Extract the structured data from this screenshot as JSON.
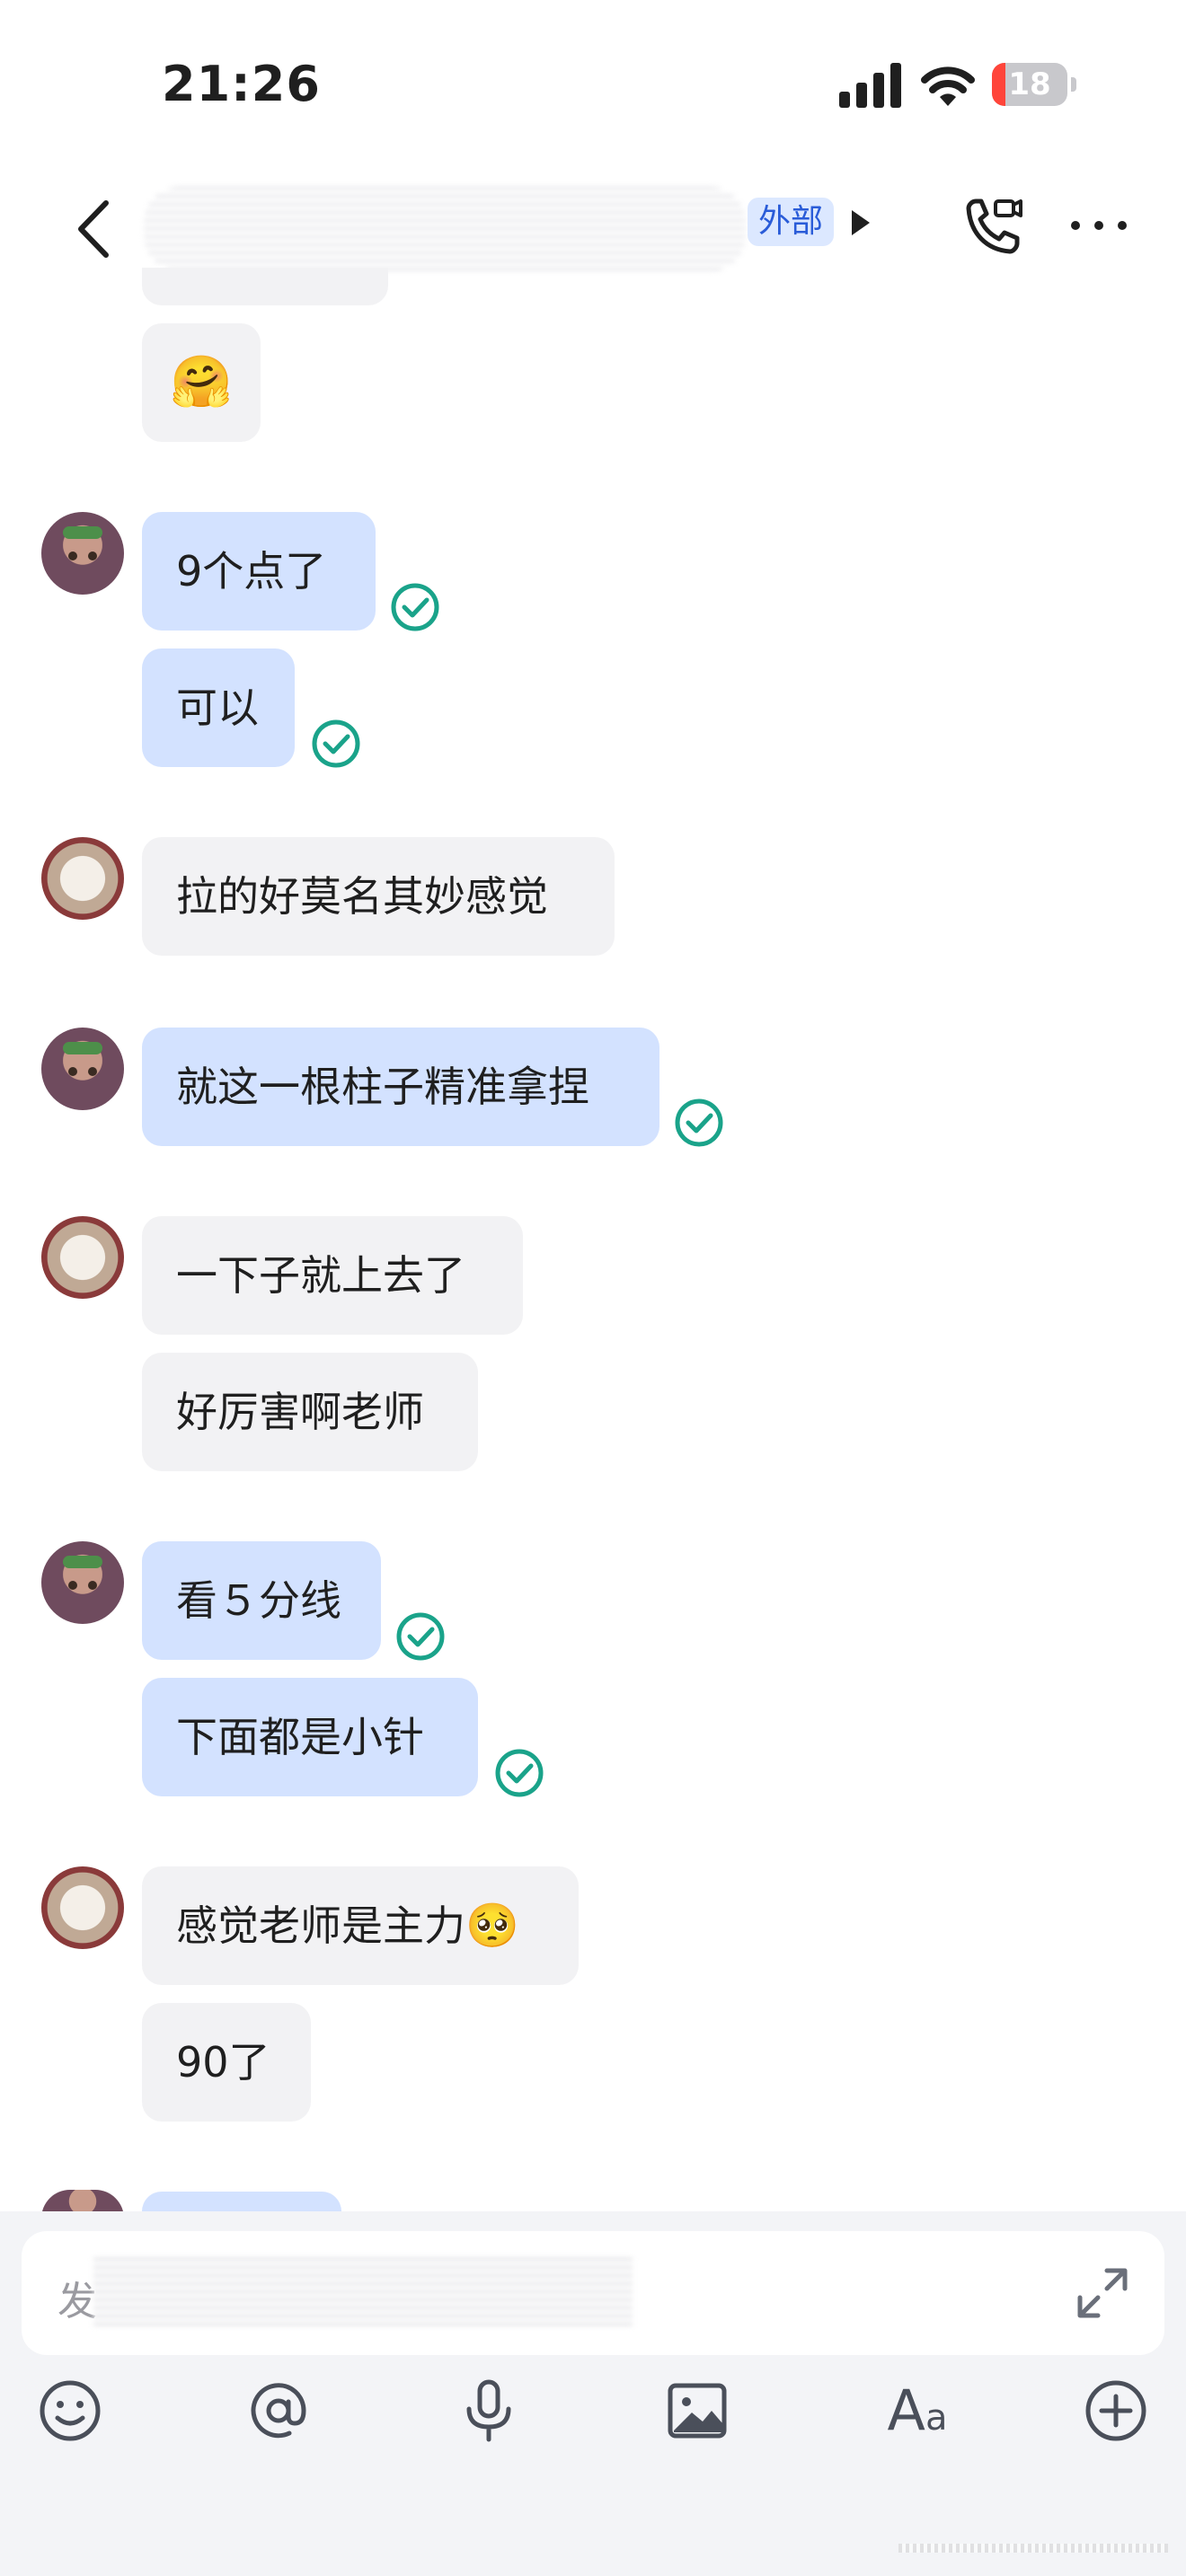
{
  "status_bar": {
    "time": "21:26",
    "battery": "18",
    "battery_level": 0.18
  },
  "nav": {
    "tag": "外部"
  },
  "messages": [
    {
      "text": "9个点了"
    },
    {
      "text": "可以"
    },
    {
      "text": "拉的好莫名其妙感觉"
    },
    {
      "text": "就这一根柱子精准拿捏"
    },
    {
      "text": "一下子就上去了"
    },
    {
      "text": "好厉害啊老师"
    },
    {
      "text": "看５分线"
    },
    {
      "text": "下面都是小针"
    },
    {
      "text": "感觉老师是主力"
    },
    {
      "text": "90了"
    }
  ],
  "composer": {
    "placeholder": "发"
  },
  "icons": {
    "emoji": "smile-icon",
    "mention": "at-icon",
    "voice": "microphone-icon",
    "image": "image-icon",
    "format": "text-format-icon",
    "more": "plus-circle-icon"
  },
  "colors": {
    "my_bubble": "#d3e2ff",
    "peer_bubble": "#f2f2f4",
    "check": "#1aa38a",
    "tag_bg": "#dce8ff",
    "tag_text": "#2a5cd8"
  }
}
